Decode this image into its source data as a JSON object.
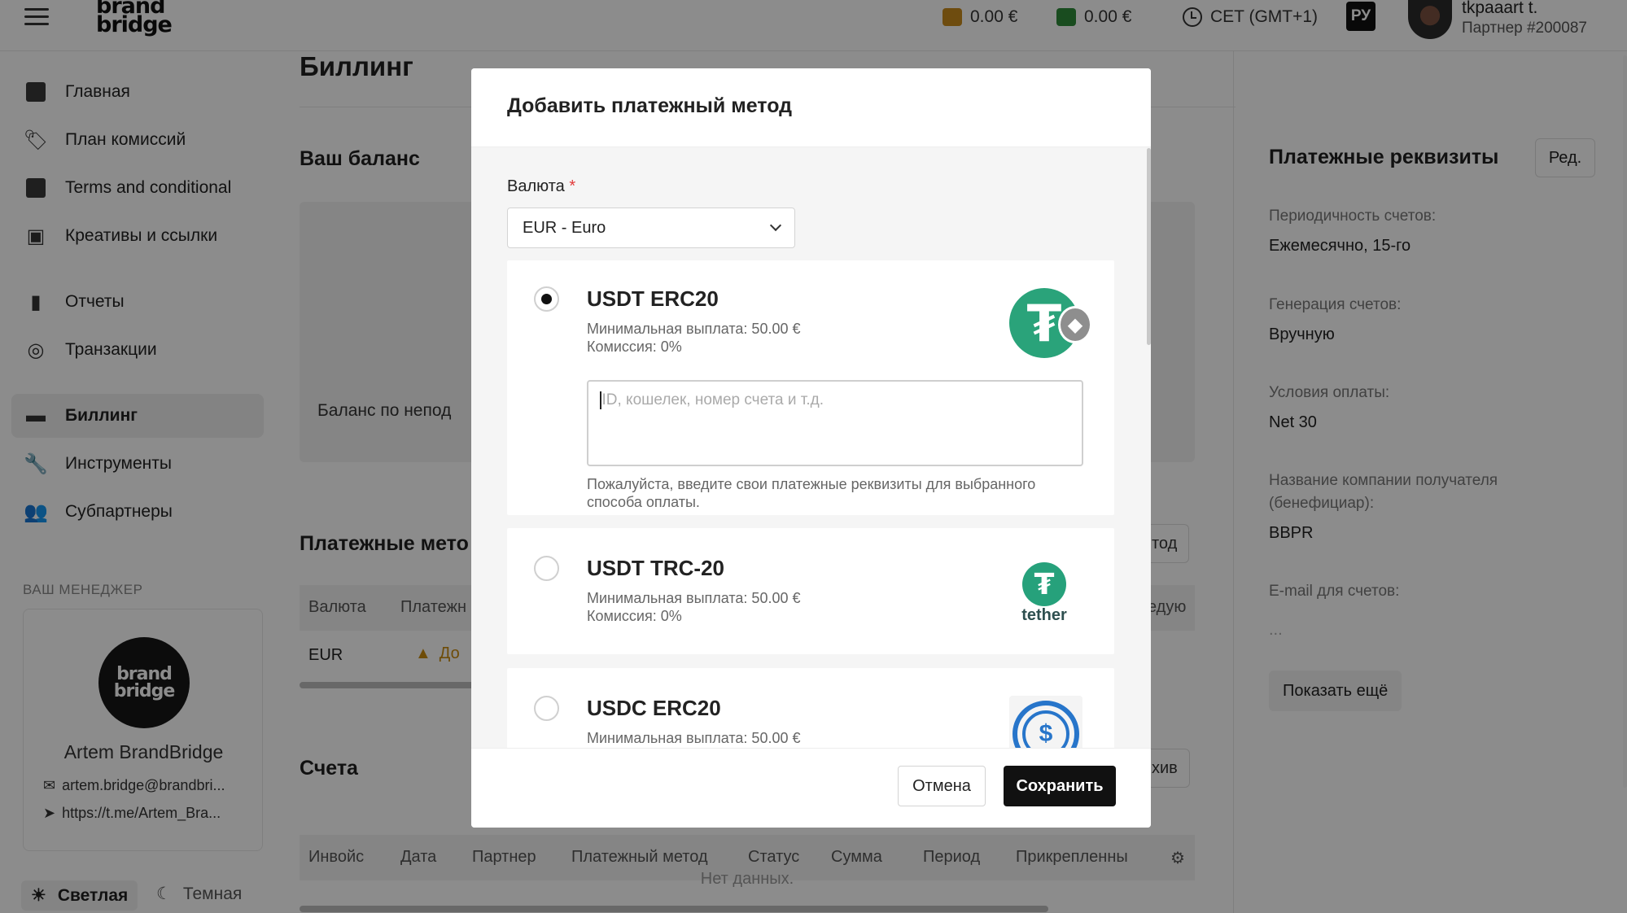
{
  "header": {
    "brand_line1": "brand",
    "brand_line2": "bridge",
    "wallet1": "0.00 €",
    "wallet2": "0.00 €",
    "timezone": "CET (GMT+1)",
    "lang": "РУ",
    "user_name": "tkpaaart t.",
    "user_sub": "Партнер #200087"
  },
  "sidebar": {
    "items": [
      {
        "label": "Главная",
        "icon": "dashboard-icon"
      },
      {
        "label": "План комиссий",
        "icon": "tag-icon"
      },
      {
        "label": "Terms and conditional",
        "icon": "document-icon"
      },
      {
        "label": "Креативы и ссылки",
        "icon": "image-icon"
      },
      {
        "label": "Отчеты",
        "icon": "bar-chart-icon"
      },
      {
        "label": "Транзакции",
        "icon": "transactions-icon"
      },
      {
        "label": "Биллинг",
        "icon": "credit-card-icon"
      },
      {
        "label": "Инструменты",
        "icon": "wrench-icon"
      },
      {
        "label": "Субпартнеры",
        "icon": "users-icon"
      }
    ],
    "manager_title": "ВАШ МЕНЕДЖЕР",
    "manager_logo_1": "brand",
    "manager_logo_2": "bridge",
    "manager_name": "Artem BrandBridge",
    "manager_email": "artem.bridge@brandbri...",
    "manager_telegram": "https://t.me/Artem_Bra...",
    "theme_light": "Светлая",
    "theme_dark": "Темная"
  },
  "main": {
    "title": "Биллинг",
    "balance_title": "Ваш баланс",
    "balance_label": "Баланс по непод",
    "methods_title": "Платежные мето",
    "methods_btn": "тод",
    "methods_cols": [
      "Валюта",
      "Платежн",
      "едую"
    ],
    "methods_row_currency": "EUR",
    "methods_row_status": "До",
    "invoices_title": "Счета",
    "invoices_btn": "хив",
    "invoice_cols": [
      "Инвойс",
      "Дата",
      "Партнер",
      "Платежный метод",
      "Статус",
      "Сумма",
      "Период",
      "Прикрепленны"
    ],
    "no_data": "Нет данных."
  },
  "right_panel": {
    "title": "Платежные реквизиты",
    "edit": "Ред.",
    "fields": [
      {
        "label": "Периодичность счетов:",
        "value": "Ежемесячно, 15-го"
      },
      {
        "label": "Генерация счетов:",
        "value": "Вручную"
      },
      {
        "label": "Условия оплаты:",
        "value": "Net 30"
      },
      {
        "label": "Название компании получателя (бенефициар):",
        "value": "BBPR"
      },
      {
        "label": "E-mail для счетов:",
        "value": "..."
      }
    ],
    "show_more": "Показать ещё"
  },
  "modal": {
    "title": "Добавить платежный метод",
    "currency_label": "Валюта",
    "required_mark": "*",
    "currency_value": "EUR - Euro",
    "methods": [
      {
        "name": "USDT ERC20",
        "min": "Минимальная выплата: 50.00 €",
        "fee": "Комиссия: 0%",
        "selected": true,
        "logo": "tether-eth-logo"
      },
      {
        "name": "USDT TRC-20",
        "min": "Минимальная выплата: 50.00 €",
        "fee": "Комиссия: 0%",
        "selected": false,
        "logo": "tether-logo"
      },
      {
        "name": "USDC ERC20",
        "min": "Минимальная выплата: 50.00 €",
        "selected": false,
        "logo": "usdc-logo"
      }
    ],
    "details_placeholder": "ID, кошелек, номер счета и т.д.",
    "details_hint": "Пожалуйста, введите свои платежные реквизиты для выбранного способа оплаты.",
    "tether_word": "tether",
    "cancel": "Отмена",
    "save": "Сохранить"
  },
  "colors": {
    "accent": "#111111",
    "required": "#e23b3b",
    "tether_green": "#26a17b",
    "usdc_blue": "#2775ca",
    "wallet1": "#c98a1c",
    "wallet2": "#2e8b3a",
    "warning": "#e0a020"
  }
}
